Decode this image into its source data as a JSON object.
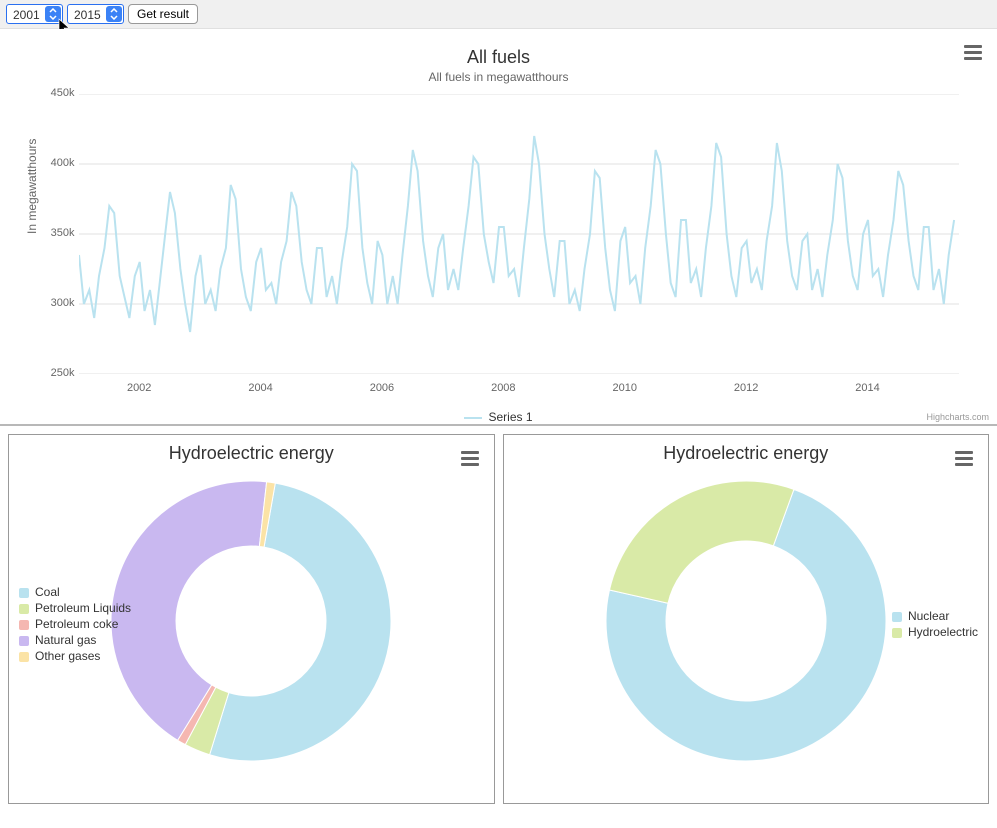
{
  "toolbar": {
    "year_from": "2001",
    "year_to": "2015",
    "get_result_label": "Get result"
  },
  "credits": "Highcharts.com",
  "main_chart": {
    "title": "All fuels",
    "subtitle": "All fuels in megawatthours",
    "yaxis_label": "In megawatthours",
    "legend_label": "Series 1"
  },
  "panel_left": {
    "title": "Hydroelectric energy"
  },
  "panel_right": {
    "title": "Hydroelectric energy"
  },
  "legend_left": {
    "items": [
      "Coal",
      "Petroleum Liquids",
      "Petroleum coke",
      "Natural gas",
      "Other gases"
    ],
    "colors": [
      "#b9e2ef",
      "#d9eaa7",
      "#f5b7b1",
      "#c9b8f0",
      "#fbe3a6"
    ]
  },
  "legend_right": {
    "items": [
      "Nuclear",
      "Hydroelectric"
    ],
    "colors": [
      "#b9e2ef",
      "#d9eaa7"
    ]
  },
  "chart_data": [
    {
      "type": "line",
      "title": "All fuels",
      "subtitle": "All fuels in megawatthours",
      "ylabel": "In megawatthours",
      "xlabel": "",
      "ylim": [
        250000,
        450000
      ],
      "yticks": [
        250000,
        300000,
        350000,
        400000,
        450000
      ],
      "xticks": [
        2002,
        2004,
        2006,
        2008,
        2010,
        2012,
        2014
      ],
      "x_range": [
        2001.0,
        2015.5
      ],
      "series": [
        {
          "name": "Series 1",
          "color": "#b9e2ef",
          "x": [
            2001.0,
            2001.08,
            2001.17,
            2001.25,
            2001.33,
            2001.42,
            2001.5,
            2001.58,
            2001.67,
            2001.75,
            2001.83,
            2001.92,
            2002.0,
            2002.08,
            2002.17,
            2002.25,
            2002.33,
            2002.42,
            2002.5,
            2002.58,
            2002.67,
            2002.75,
            2002.83,
            2002.92,
            2003.0,
            2003.08,
            2003.17,
            2003.25,
            2003.33,
            2003.42,
            2003.5,
            2003.58,
            2003.67,
            2003.75,
            2003.83,
            2003.92,
            2004.0,
            2004.08,
            2004.17,
            2004.25,
            2004.33,
            2004.42,
            2004.5,
            2004.58,
            2004.67,
            2004.75,
            2004.83,
            2004.92,
            2005.0,
            2005.08,
            2005.17,
            2005.25,
            2005.33,
            2005.42,
            2005.5,
            2005.58,
            2005.67,
            2005.75,
            2005.83,
            2005.92,
            2006.0,
            2006.08,
            2006.17,
            2006.25,
            2006.33,
            2006.42,
            2006.5,
            2006.58,
            2006.67,
            2006.75,
            2006.83,
            2006.92,
            2007.0,
            2007.08,
            2007.17,
            2007.25,
            2007.33,
            2007.42,
            2007.5,
            2007.58,
            2007.67,
            2007.75,
            2007.83,
            2007.92,
            2008.0,
            2008.08,
            2008.17,
            2008.25,
            2008.33,
            2008.42,
            2008.5,
            2008.58,
            2008.67,
            2008.75,
            2008.83,
            2008.92,
            2009.0,
            2009.08,
            2009.17,
            2009.25,
            2009.33,
            2009.42,
            2009.5,
            2009.58,
            2009.67,
            2009.75,
            2009.83,
            2009.92,
            2010.0,
            2010.08,
            2010.17,
            2010.25,
            2010.33,
            2010.42,
            2010.5,
            2010.58,
            2010.67,
            2010.75,
            2010.83,
            2010.92,
            2011.0,
            2011.08,
            2011.17,
            2011.25,
            2011.33,
            2011.42,
            2011.5,
            2011.58,
            2011.67,
            2011.75,
            2011.83,
            2011.92,
            2012.0,
            2012.08,
            2012.17,
            2012.25,
            2012.33,
            2012.42,
            2012.5,
            2012.58,
            2012.67,
            2012.75,
            2012.83,
            2012.92,
            2013.0,
            2013.08,
            2013.17,
            2013.25,
            2013.33,
            2013.42,
            2013.5,
            2013.58,
            2013.67,
            2013.75,
            2013.83,
            2013.92,
            2014.0,
            2014.08,
            2014.17,
            2014.25,
            2014.33,
            2014.42,
            2014.5,
            2014.58,
            2014.67,
            2014.75,
            2014.83,
            2014.92,
            2015.0,
            2015.08,
            2015.17,
            2015.25,
            2015.33,
            2015.42
          ],
          "values": [
            335000,
            300000,
            310000,
            290000,
            320000,
            340000,
            370000,
            365000,
            320000,
            305000,
            290000,
            320000,
            330000,
            295000,
            310000,
            285000,
            315000,
            350000,
            380000,
            365000,
            325000,
            300000,
            280000,
            320000,
            335000,
            300000,
            310000,
            295000,
            325000,
            340000,
            385000,
            375000,
            325000,
            305000,
            295000,
            330000,
            340000,
            310000,
            315000,
            300000,
            330000,
            345000,
            380000,
            370000,
            330000,
            310000,
            300000,
            340000,
            340000,
            305000,
            320000,
            300000,
            330000,
            355000,
            400000,
            395000,
            340000,
            315000,
            300000,
            345000,
            335000,
            300000,
            320000,
            300000,
            335000,
            370000,
            410000,
            395000,
            345000,
            320000,
            305000,
            340000,
            350000,
            310000,
            325000,
            310000,
            340000,
            370000,
            405000,
            400000,
            350000,
            330000,
            315000,
            355000,
            355000,
            320000,
            325000,
            305000,
            340000,
            375000,
            420000,
            400000,
            350000,
            325000,
            305000,
            345000,
            345000,
            300000,
            310000,
            295000,
            325000,
            350000,
            395000,
            390000,
            340000,
            310000,
            295000,
            345000,
            355000,
            315000,
            320000,
            300000,
            340000,
            370000,
            410000,
            400000,
            350000,
            315000,
            305000,
            360000,
            360000,
            315000,
            325000,
            305000,
            340000,
            370000,
            415000,
            405000,
            350000,
            320000,
            305000,
            340000,
            345000,
            315000,
            325000,
            310000,
            345000,
            370000,
            415000,
            395000,
            345000,
            320000,
            310000,
            345000,
            350000,
            310000,
            325000,
            305000,
            335000,
            360000,
            400000,
            390000,
            345000,
            320000,
            310000,
            350000,
            360000,
            320000,
            325000,
            305000,
            335000,
            360000,
            395000,
            385000,
            345000,
            320000,
            310000,
            355000,
            355000,
            310000,
            325000,
            300000,
            335000,
            360000
          ]
        }
      ]
    },
    {
      "type": "pie",
      "title": "Hydroelectric energy",
      "series": [
        {
          "name": "Coal",
          "value": 52,
          "color": "#b9e2ef"
        },
        {
          "name": "Petroleum Liquids",
          "value": 3,
          "color": "#d9eaa7"
        },
        {
          "name": "Petroleum coke",
          "value": 1,
          "color": "#f5b7b1"
        },
        {
          "name": "Natural gas",
          "value": 43,
          "color": "#c9b8f0"
        },
        {
          "name": "Other gases",
          "value": 1,
          "color": "#fbe3a6"
        }
      ]
    },
    {
      "type": "pie",
      "title": "Hydroelectric energy",
      "series": [
        {
          "name": "Nuclear",
          "value": 73,
          "color": "#b9e2ef"
        },
        {
          "name": "Hydroelectric",
          "value": 27,
          "color": "#d9eaa7"
        }
      ]
    }
  ]
}
